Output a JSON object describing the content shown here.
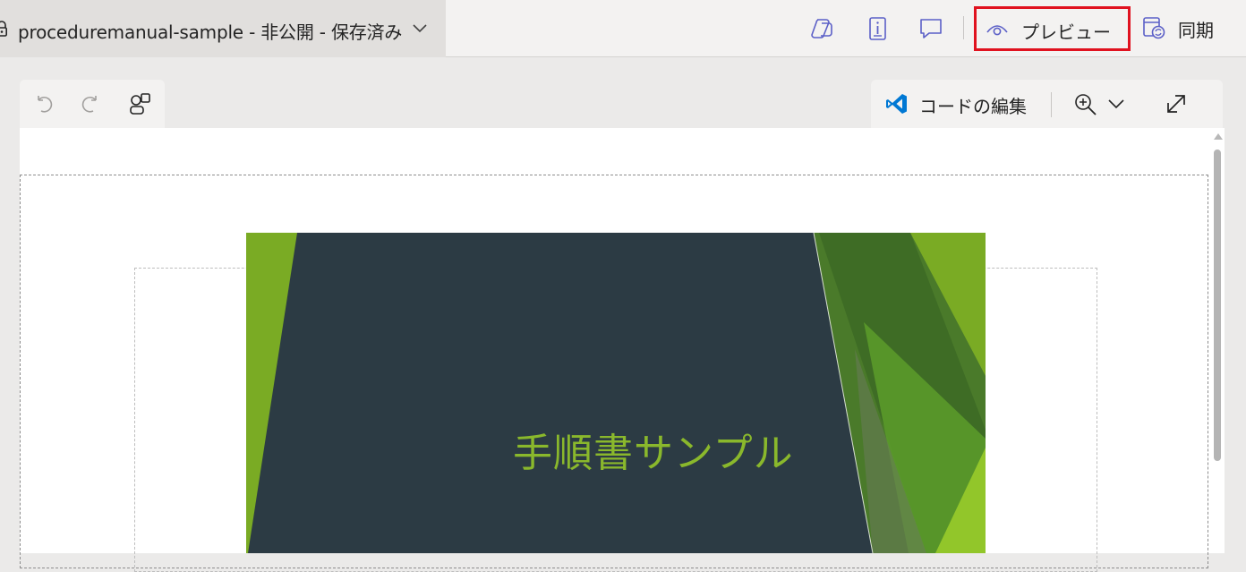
{
  "header": {
    "document_title": "proceduremanual-sample - 非公開 - 保存済み",
    "icons": [
      "copilot-icon",
      "info-icon",
      "comment-icon"
    ],
    "preview_label": "プレビュー",
    "sync_label": "同期"
  },
  "editor_toolbar": {
    "left_icons": [
      "undo-icon",
      "redo-icon",
      "shapes-icon"
    ],
    "code_edit_label": "コードの編集",
    "right_icons": [
      "zoom-in-icon",
      "chevron-down-icon",
      "expand-icon"
    ]
  },
  "slide": {
    "title": "手順書サンプル"
  },
  "colors": {
    "highlight_border": "#e0121f",
    "slide_background": "#2c3b44",
    "slide_title": "#8ab82c",
    "slide_accent_green": "#7aab24",
    "icon_blue": "#5b5fc7"
  }
}
